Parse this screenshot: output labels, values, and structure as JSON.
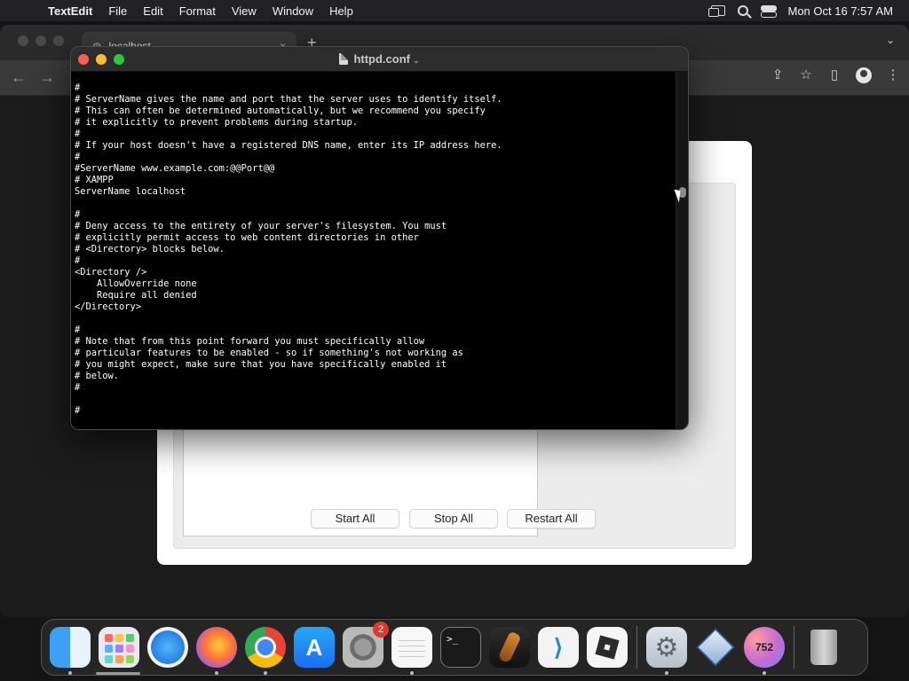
{
  "menubar": {
    "apple_icon": "apple-logo-icon",
    "app_name": "TextEdit",
    "menus": [
      "File",
      "Edit",
      "Format",
      "View",
      "Window",
      "Help"
    ],
    "status_icons": [
      "screen-mirroring-icon",
      "spotlight-search-icon",
      "control-center-icon"
    ],
    "clock": "Mon Oct 16  7:57 AM"
  },
  "browser": {
    "tab_title": "localhost",
    "tab_close": "×",
    "new_tab": "+",
    "tab_menu": "⌄",
    "back": "←",
    "forward": "→",
    "toolbar_icons": [
      "share-icon",
      "bookmark-star-icon",
      "sidebar-icon",
      "profile-icon",
      "more-menu-icon"
    ]
  },
  "xampp": {
    "buttons": {
      "start_all": "Start All",
      "stop_all": "Stop All",
      "restart_all": "Restart All"
    }
  },
  "textedit": {
    "title": "httpd.conf",
    "title_chevron": "⌄",
    "lines": [
      "#",
      "# ServerName gives the name and port that the server uses to identify itself.",
      "# This can often be determined automatically, but we recommend you specify",
      "# it explicitly to prevent problems during startup.",
      "#",
      "# If your host doesn't have a registered DNS name, enter its IP address here.",
      "#",
      "#ServerName www.example.com:@@Port@@",
      "# XAMPP",
      "ServerName localhost",
      "",
      "#",
      "# Deny access to the entirety of your server's filesystem. You must",
      "# explicitly permit access to web content directories in other",
      "# <Directory> blocks below.",
      "#",
      "<Directory />",
      "    AllowOverride none",
      "    Require all denied",
      "</Directory>",
      "",
      "#",
      "# Note that from this point forward you must specifically allow",
      "# particular features to be enabled - so if something's not working as",
      "# you might expect, make sure that you have specifically enabled it",
      "# below.",
      "#",
      "",
      "#"
    ]
  },
  "dock": {
    "apps": [
      {
        "name": "Finder",
        "icon": "finder-icon",
        "running": true
      },
      {
        "name": "Launchpad",
        "icon": "launchpad-icon",
        "running": false
      },
      {
        "name": "Safari",
        "icon": "safari-icon",
        "running": false
      },
      {
        "name": "Firefox",
        "icon": "firefox-icon",
        "running": true
      },
      {
        "name": "Google Chrome",
        "icon": "chrome-icon",
        "running": true
      },
      {
        "name": "App Store",
        "icon": "app-store-icon",
        "running": false
      },
      {
        "name": "System Settings",
        "icon": "system-settings-icon",
        "running": false,
        "badge": "2"
      },
      {
        "name": "TextEdit",
        "icon": "textedit-icon",
        "running": true
      },
      {
        "name": "Terminal",
        "icon": "terminal-icon",
        "running": false,
        "glyph": ">_"
      },
      {
        "name": "GarageBand",
        "icon": "garageband-icon",
        "running": false
      },
      {
        "name": "Visual Studio Code",
        "icon": "vscode-icon",
        "running": false
      },
      {
        "name": "Roblox",
        "icon": "roblox-icon",
        "running": false
      }
    ],
    "recent": [
      {
        "name": "XAMPP Manager",
        "icon": "xampp-manager-icon",
        "running": true
      },
      {
        "name": "VirtualBox",
        "icon": "virtualbox-icon",
        "running": false
      },
      {
        "name": "Counter",
        "icon": "counter-icon",
        "running": true,
        "label": "752"
      }
    ],
    "trash": {
      "name": "Trash",
      "icon": "trash-icon"
    }
  },
  "colors": {
    "close": "#ff5f57",
    "minimize": "#febc2e",
    "zoom": "#28c840",
    "badge": "#e5352d"
  }
}
